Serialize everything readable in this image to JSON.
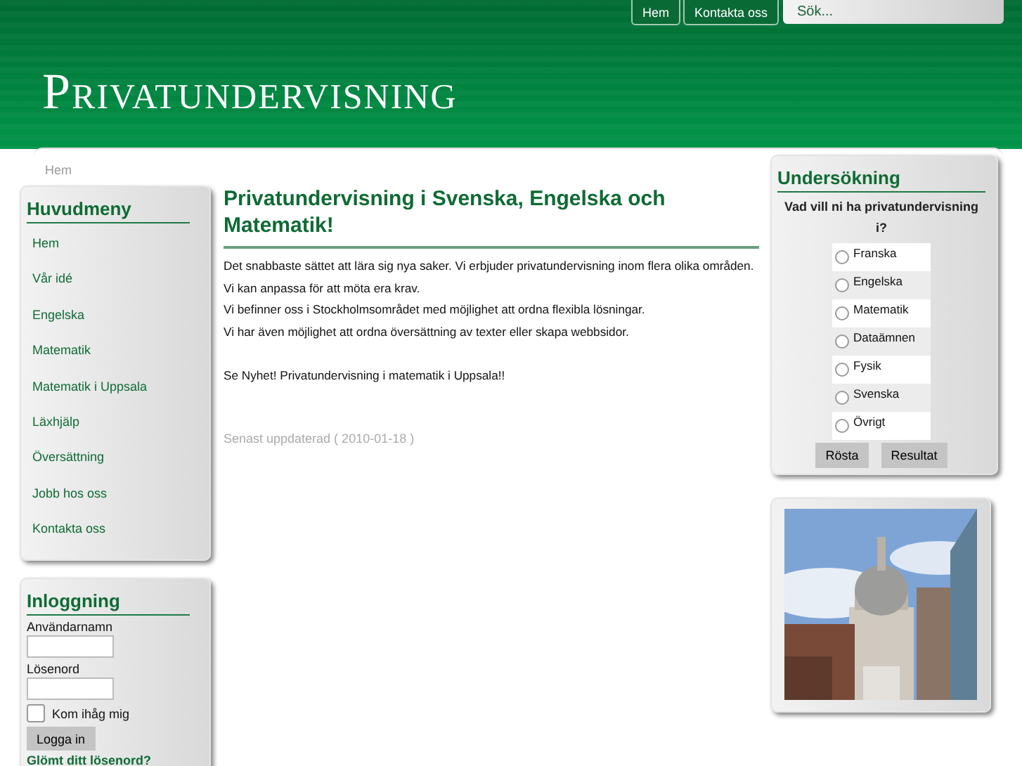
{
  "header": {
    "nav": [
      {
        "label": "Hem"
      },
      {
        "label": "Kontakta oss"
      }
    ],
    "search": {
      "placeholder": "Sök..."
    },
    "site_title": "Privatundervisning"
  },
  "breadcrumb": "Hem",
  "main_menu": {
    "title": "Huvudmeny",
    "items": [
      "Hem",
      "Vår idé",
      "Engelska",
      "Matematik",
      "Matematik i Uppsala",
      "Läxhjälp",
      "Översättning",
      "Jobb hos oss",
      "Kontakta oss"
    ]
  },
  "login": {
    "title": "Inloggning",
    "username_label": "Användarnamn",
    "password_label": "Lösenord",
    "remember": {
      "label": "Kom ihåg mig",
      "checked": false
    },
    "button": "Logga in",
    "forgot_link": "Glömt ditt lösenord?"
  },
  "article": {
    "title": "Privatundervisning i Svenska, Engelska och Matematik!",
    "paragraphs": [
      [
        "Det snabbaste sättet att lära sig nya saker. Vi erbjuder privatundervisning inom flera olika områden. Vi kan anpassa för att möta era krav.",
        "Vi befinner oss i Stockholmsområdet med möjlighet att ordna flexibla lösningar.",
        "Vi har även möjlighet att ordna översättning av texter eller skapa webbsidor."
      ],
      [
        "Se Nyhet! Privatundervisning i matematik i Uppsala!!"
      ]
    ],
    "updated": "Senast uppdaterad ( 2010-01-18 )"
  },
  "poll": {
    "title": "Undersökning",
    "question": "Vad vill ni ha privatundervisning i?",
    "options": [
      {
        "label": "Franska",
        "selected": false
      },
      {
        "label": "Engelska",
        "selected": false
      },
      {
        "label": "Matematik",
        "selected": false
      },
      {
        "label": "Dataämnen",
        "selected": false
      },
      {
        "label": "Fysik",
        "selected": false
      },
      {
        "label": "Svenska",
        "selected": false
      },
      {
        "label": "Övrigt",
        "selected": false
      }
    ],
    "buttons": [
      "Rösta",
      "Resultat"
    ]
  }
}
